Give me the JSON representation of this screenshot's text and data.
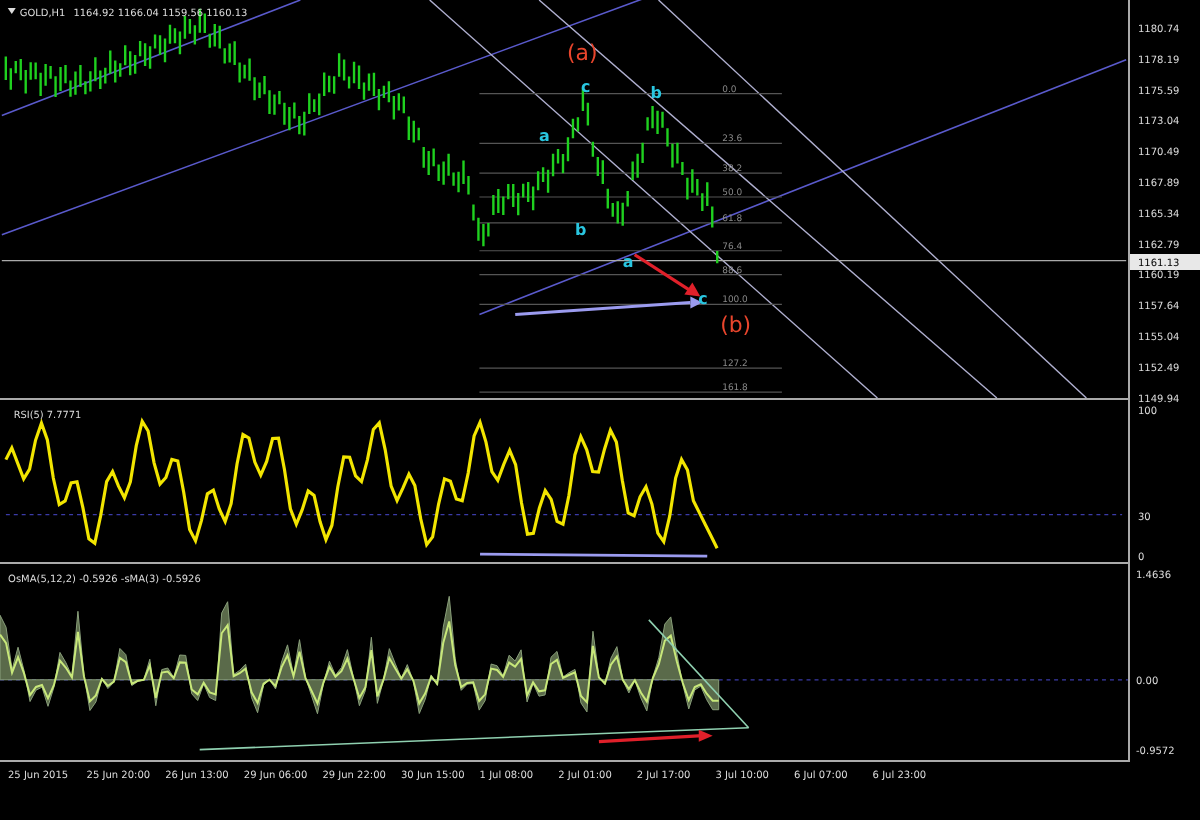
{
  "header": {
    "symbol": "GOLD,H1",
    "quote": "1164.92 1166.04 1159.56 1160.13"
  },
  "price_axis": [
    "1180.74",
    "1178.19",
    "1175.59",
    "1173.04",
    "1170.49",
    "1167.89",
    "1165.34",
    "1162.79",
    "1160.19",
    "1157.64",
    "1155.04",
    "1152.49",
    "1149.94"
  ],
  "current_price": "1161.13",
  "wave_labels": [
    {
      "text": "(a)",
      "kind": "major"
    },
    {
      "text": "c",
      "kind": "minor"
    },
    {
      "text": "b",
      "kind": "minor"
    },
    {
      "text": "a",
      "kind": "minor"
    },
    {
      "text": "b",
      "kind": "minor"
    },
    {
      "text": "a",
      "kind": "minor"
    },
    {
      "text": "c",
      "kind": "minor"
    },
    {
      "text": "(b)",
      "kind": "major"
    }
  ],
  "fib_levels": [
    "0.0",
    "23.6",
    "38.2",
    "50.0",
    "61.8",
    "76.4",
    "88.6",
    "100.0",
    "127.2",
    "161.8"
  ],
  "rsi": {
    "label": "RSI(5) 7.7771",
    "axis": [
      "100",
      "30",
      "0"
    ]
  },
  "osma": {
    "label": "OsMA(5,12,2) -0.5926 -sMA(3) -0.5926",
    "axis": [
      "1.4636",
      "0.00",
      "-0.9572"
    ]
  },
  "time_axis": [
    "25 Jun 2015",
    "25 Jun 20:00",
    "26 Jun 13:00",
    "29 Jun 06:00",
    "29 Jun 22:00",
    "30 Jun 15:00",
    "1 Jul 08:00",
    "2 Jul 01:00",
    "2 Jul 17:00",
    "3 Jul 10:00",
    "6 Jul 07:00",
    "6 Jul 23:00"
  ]
}
